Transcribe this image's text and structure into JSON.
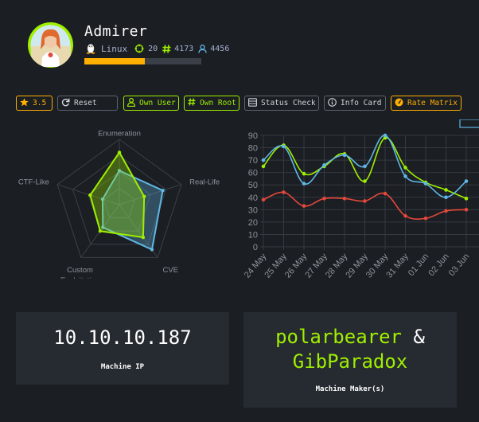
{
  "machine": {
    "name": "Admirer",
    "os": "Linux",
    "points": "20",
    "user_owns": "4173",
    "root_owns": "4456",
    "progress_fraction": 0.52
  },
  "toolbar": {
    "rating": "3.5",
    "reset": "Reset",
    "own_user": "Own User",
    "own_root": "Own Root",
    "status_check": "Status Check",
    "info_card": "Info Card",
    "rate_matrix": "Rate Matrix"
  },
  "radar": {
    "axes": [
      "Enumeration",
      "Real-Life",
      "CVE",
      "Custom Exploitation",
      "CTF-Like"
    ],
    "axis_label_lines": [
      [
        "Enumeration"
      ],
      [
        "Real-Life"
      ],
      [
        "CVE"
      ],
      [
        "Custom",
        "Exploitation"
      ],
      [
        "CTF-Like"
      ]
    ],
    "max": 10,
    "series": [
      {
        "values": [
          5.2,
          7.0,
          8.5,
          4.3,
          2.7
        ],
        "color": "#5fb7e4"
      },
      {
        "values": [
          8.0,
          4.0,
          6.2,
          5.0,
          4.7
        ],
        "color": "#9fef00"
      }
    ]
  },
  "chart_data": {
    "type": "line",
    "categories": [
      "24 May",
      "25 May",
      "26 May",
      "27 May",
      "28 May",
      "29 May",
      "30 May",
      "31 May",
      "01 Jun",
      "02 Jun",
      "03 Jun"
    ],
    "ylim": [
      0,
      90
    ],
    "yticks": [
      0,
      10,
      20,
      30,
      40,
      50,
      60,
      70,
      80,
      90
    ],
    "grid": true,
    "series": [
      {
        "values": [
          70,
          81,
          51,
          66,
          74,
          65,
          90,
          57,
          51,
          40,
          53
        ],
        "color": "#5fb7e4"
      },
      {
        "values": [
          65,
          82,
          59,
          65,
          75,
          53,
          88,
          64,
          52,
          46,
          39
        ],
        "color": "#9fef00"
      },
      {
        "values": [
          38,
          44,
          33,
          39,
          39,
          37,
          43,
          25,
          23,
          29,
          30
        ],
        "color": "#e5483a"
      }
    ]
  },
  "ip_card": {
    "value": "10.10.10.187",
    "label": "Machine IP"
  },
  "maker_card": {
    "name1": "polarbearer",
    "amp": "&",
    "name2": "GibParadox",
    "label": "Machine Maker(s)"
  }
}
